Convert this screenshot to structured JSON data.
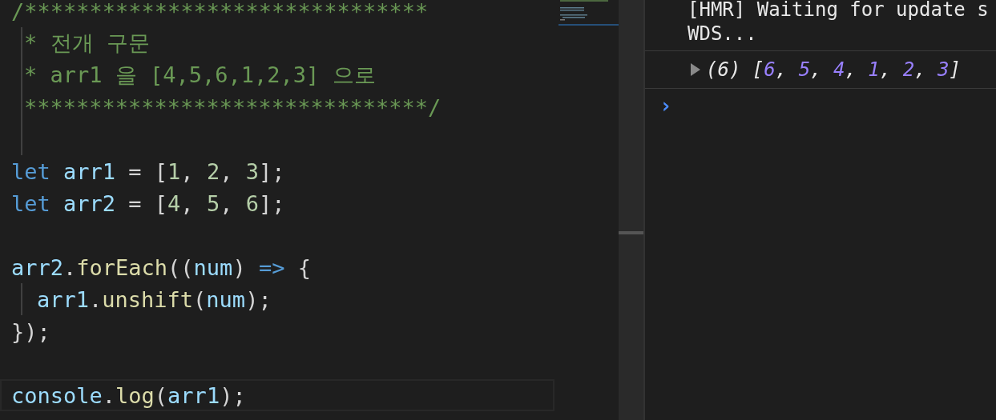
{
  "editor": {
    "lines": [
      {
        "kind": "code",
        "active": false,
        "tokens": [
          {
            "text": "/*******************************",
            "kind": "comment"
          }
        ]
      },
      {
        "kind": "guided",
        "active": false,
        "tokens": [
          {
            "text": "* 전개 구문",
            "kind": "comment"
          }
        ]
      },
      {
        "kind": "guided",
        "active": false,
        "tokens": [
          {
            "text": "* arr1 을 [4,5,6,1,2,3] 으로",
            "kind": "comment"
          }
        ]
      },
      {
        "kind": "guided",
        "active": false,
        "tokens": [
          {
            "text": "*******************************/",
            "kind": "comment"
          }
        ]
      },
      {
        "kind": "guided_blank",
        "active": false
      },
      {
        "kind": "code",
        "active": false,
        "tokens": [
          {
            "text": "let",
            "kind": "keyword"
          },
          {
            "text": " arr1",
            "kind": "variable"
          },
          {
            "text": " = [",
            "kind": "punct"
          },
          {
            "text": "1",
            "kind": "number"
          },
          {
            "text": ", ",
            "kind": "punct"
          },
          {
            "text": "2",
            "kind": "number"
          },
          {
            "text": ", ",
            "kind": "punct"
          },
          {
            "text": "3",
            "kind": "number"
          },
          {
            "text": "];",
            "kind": "punct"
          }
        ]
      },
      {
        "kind": "code",
        "active": false,
        "tokens": [
          {
            "text": "let",
            "kind": "keyword"
          },
          {
            "text": " arr2",
            "kind": "variable"
          },
          {
            "text": " = [",
            "kind": "punct"
          },
          {
            "text": "4",
            "kind": "number"
          },
          {
            "text": ", ",
            "kind": "punct"
          },
          {
            "text": "5",
            "kind": "number"
          },
          {
            "text": ", ",
            "kind": "punct"
          },
          {
            "text": "6",
            "kind": "number"
          },
          {
            "text": "];",
            "kind": "punct"
          }
        ]
      },
      {
        "kind": "blank",
        "active": false
      },
      {
        "kind": "code",
        "active": false,
        "tokens": [
          {
            "text": "arr2",
            "kind": "variable"
          },
          {
            "text": ".",
            "kind": "punct"
          },
          {
            "text": "forEach",
            "kind": "function"
          },
          {
            "text": "((",
            "kind": "punct"
          },
          {
            "text": "num",
            "kind": "variable"
          },
          {
            "text": ") ",
            "kind": "punct"
          },
          {
            "text": "=>",
            "kind": "keyword"
          },
          {
            "text": " {",
            "kind": "punct"
          }
        ]
      },
      {
        "kind": "indented",
        "active": false,
        "tokens": [
          {
            "text": "arr1",
            "kind": "variable"
          },
          {
            "text": ".",
            "kind": "punct"
          },
          {
            "text": "unshift",
            "kind": "function"
          },
          {
            "text": "(",
            "kind": "punct"
          },
          {
            "text": "num",
            "kind": "variable"
          },
          {
            "text": ");",
            "kind": "punct"
          }
        ]
      },
      {
        "kind": "code",
        "active": false,
        "tokens": [
          {
            "text": "});",
            "kind": "punct"
          }
        ]
      },
      {
        "kind": "blank",
        "active": false
      },
      {
        "kind": "code",
        "active": true,
        "tokens": [
          {
            "text": "console",
            "kind": "variable"
          },
          {
            "text": ".",
            "kind": "punct"
          },
          {
            "text": "log",
            "kind": "function"
          },
          {
            "text": "(",
            "kind": "punct"
          },
          {
            "text": "arr1",
            "kind": "variable"
          },
          {
            "text": ");",
            "kind": "punct"
          }
        ]
      }
    ]
  },
  "console": {
    "message_lines": [
      "[HMR] Waiting for update s",
      "WDS..."
    ],
    "log": {
      "expanded": false,
      "count": "(6)",
      "open": "[",
      "values": [
        "6",
        "5",
        "4",
        "1",
        "2",
        "3"
      ],
      "separator": ", ",
      "close": "]"
    },
    "prompt": "›"
  }
}
